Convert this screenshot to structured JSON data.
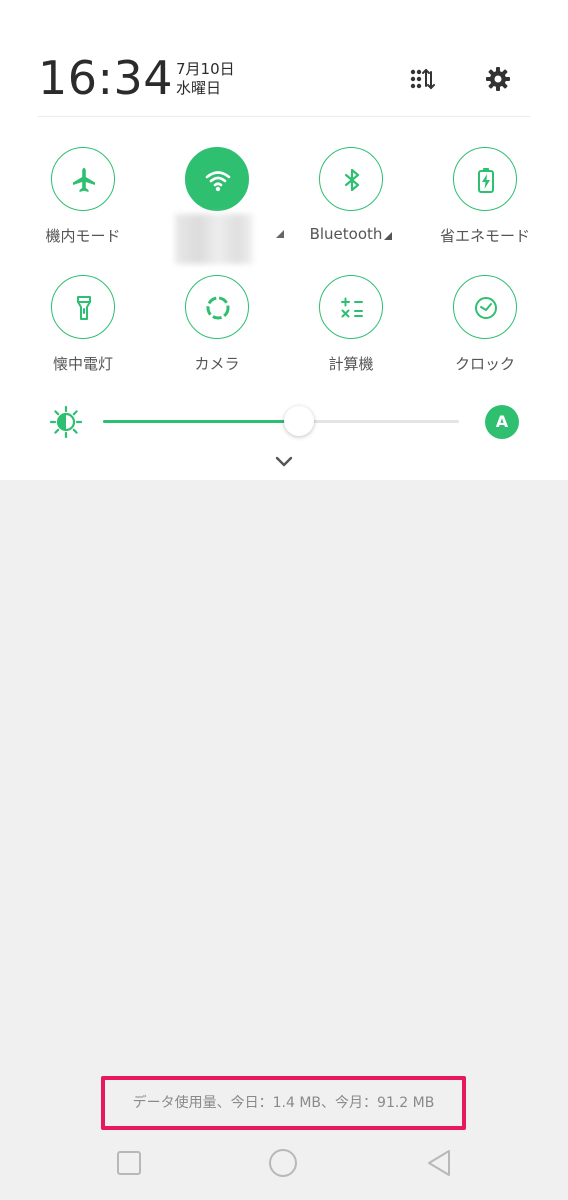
{
  "header": {
    "time": "16:34",
    "date": "7月10日",
    "weekday": "水曜日",
    "edit_icon": "grid-sort-icon",
    "settings_icon": "gear-icon"
  },
  "tiles": [
    {
      "label": "機内モード",
      "icon": "airplane-icon",
      "active": false
    },
    {
      "label": "",
      "icon": "wifi-icon",
      "active": true
    },
    {
      "label": "Bluetooth",
      "icon": "bluetooth-icon",
      "active": false
    },
    {
      "label": "省エネモード",
      "icon": "battery-saver-icon",
      "active": false
    },
    {
      "label": "懐中電灯",
      "icon": "flashlight-icon",
      "active": false
    },
    {
      "label": "カメラ",
      "icon": "camera-icon",
      "active": false
    },
    {
      "label": "計算機",
      "icon": "calculator-icon",
      "active": false
    },
    {
      "label": "クロック",
      "icon": "clock-icon",
      "active": false
    }
  ],
  "brightness": {
    "level_fraction": 0.55,
    "auto_label": "A"
  },
  "data_usage": {
    "text": "データ使用量、今日：1.4 MB、今月：91.2 MB"
  },
  "colors": {
    "accent": "#2fbf71",
    "highlight_border": "#e8185f",
    "panel_bg": "#ffffff",
    "screen_bg": "#f0f0f0"
  },
  "nav": {
    "recents_icon": "square-icon",
    "home_icon": "circle-icon",
    "back_icon": "triangle-back-icon"
  }
}
